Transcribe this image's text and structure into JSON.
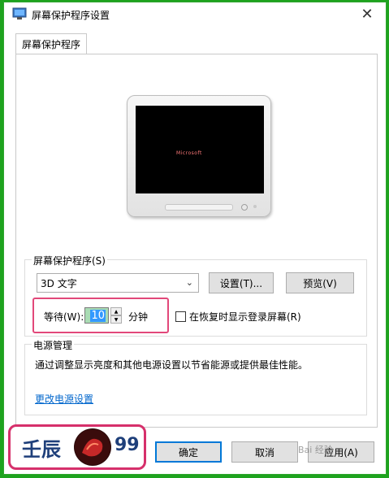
{
  "window": {
    "title": "屏幕保护程序设置"
  },
  "tabs": [
    {
      "label": "屏幕保护程序"
    }
  ],
  "preview": {
    "screen_text": "Microsoft"
  },
  "screensaver": {
    "group_label": "屏幕保护程序(S)",
    "selected": "3D 文字",
    "settings_button": "设置(T)...",
    "preview_button": "预览(V)",
    "wait_label": "等待(W):",
    "wait_value": "10",
    "minutes_label": "分钟",
    "resume_checkbox_label": "在恢复时显示登录屏幕(R)"
  },
  "power": {
    "group_label": "电源管理",
    "description": "通过调整显示亮度和其他电源设置以节省能源或提供最佳性能。",
    "link": "更改电源设置"
  },
  "footer": {
    "ok": "确定",
    "cancel": "取消",
    "apply": "应用(A)"
  },
  "watermark": {
    "text": "壬辰",
    "number": "99",
    "corner": "Bai 经验"
  },
  "colors": {
    "border_green": "#1ea31e",
    "highlight_pink": "#e2487a",
    "link_blue": "#0066cc"
  }
}
